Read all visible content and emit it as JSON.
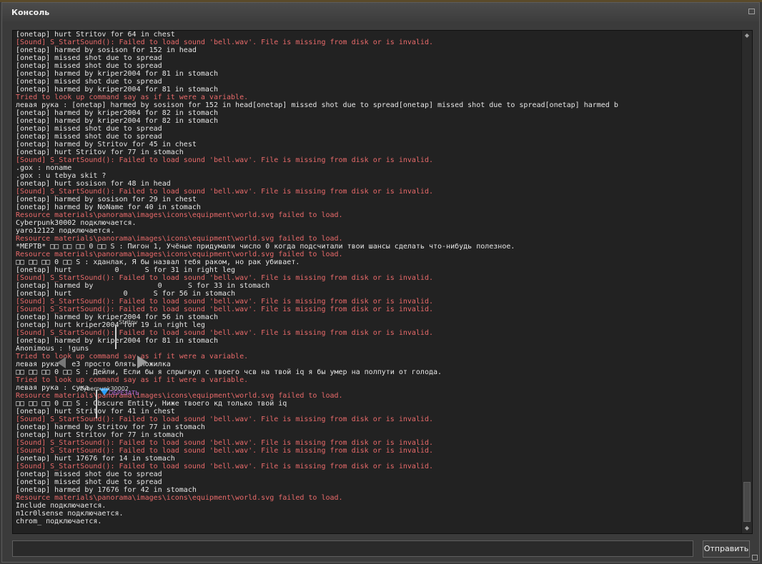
{
  "window": {
    "title": "Консоль",
    "submit_label": "Отправить",
    "input_value": ""
  },
  "log": [
    {
      "c": "white",
      "t": "[onetap] hurt Stritov for 64 in chest"
    },
    {
      "c": "red",
      "t": "[Sound] S_StartSound(): Failed to load sound 'bell.wav'. File is missing from disk or is invalid."
    },
    {
      "c": "white",
      "t": "[onetap] harmed by sosison for 152 in head"
    },
    {
      "c": "white",
      "t": "[onetap] missed shot due to spread"
    },
    {
      "c": "white",
      "t": "[onetap] missed shot due to spread"
    },
    {
      "c": "white",
      "t": "[onetap] harmed by kriper2004 for 81 in stomach"
    },
    {
      "c": "white",
      "t": "[onetap] missed shot due to spread"
    },
    {
      "c": "white",
      "t": "[onetap] harmed by kriper2004 for 81 in stomach"
    },
    {
      "c": "red",
      "t": "Tried to look up command say as if it were a variable."
    },
    {
      "c": "white",
      "t": "левая рука : [onetap] harmed by sosison for 152 in head[onetap] missed shot due to spread[onetap] missed shot due to spread[onetap] harmed b"
    },
    {
      "c": "white",
      "t": "[onetap] harmed by kriper2004 for 82 in stomach"
    },
    {
      "c": "white",
      "t": "[onetap] harmed by kriper2004 for 82 in stomach"
    },
    {
      "c": "white",
      "t": "[onetap] missed shot due to spread"
    },
    {
      "c": "white",
      "t": "[onetap] missed shot due to spread"
    },
    {
      "c": "white",
      "t": "[onetap] harmed by Stritov for 45 in chest"
    },
    {
      "c": "white",
      "t": "[onetap] hurt Stritov for 77 in stomach"
    },
    {
      "c": "red",
      "t": "[Sound] S_StartSound(): Failed to load sound 'bell.wav'. File is missing from disk or is invalid."
    },
    {
      "c": "white",
      "t": ".gox : noname"
    },
    {
      "c": "white",
      "t": ".gox : u tebya skit ?"
    },
    {
      "c": "white",
      "t": "[onetap] hurt sosison for 48 in head"
    },
    {
      "c": "red",
      "t": "[Sound] S_StartSound(): Failed to load sound 'bell.wav'. File is missing from disk or is invalid."
    },
    {
      "c": "white",
      "t": "[onetap] harmed by sosison for 29 in chest"
    },
    {
      "c": "white",
      "t": "[onetap] harmed by NoName for 40 in stomach"
    },
    {
      "c": "red",
      "t": "Resource materials\\panorama\\images\\icons\\equipment\\world.svg failed to load."
    },
    {
      "c": "white",
      "t": "Cyberpunk30002 подключается."
    },
    {
      "c": "white",
      "t": "yaro12122 подключается."
    },
    {
      "c": "red",
      "t": "Resource materials\\panorama\\images\\icons\\equipment\\world.svg failed to load."
    },
    {
      "c": "white",
      "t": "*МЕРТВ* □□ □□ □□ 0 □□ S : Пигон 1, Учёные придумали число 0 когда подсчитали твои шансы сделать что-нибудь полезное."
    },
    {
      "c": "red",
      "t": "Resource materials\\panorama\\images\\icons\\equipment\\world.svg failed to load."
    },
    {
      "c": "white",
      "t": "□□ □□ □□ 0 □□ S : хданлак, Я бы назвал тебя раком, но рак убивает."
    },
    {
      "c": "white",
      "t": "[onetap] hurt          0      S for 31 in right leg"
    },
    {
      "c": "red",
      "t": "[Sound] S_StartSound(): Failed to load sound 'bell.wav'. File is missing from disk or is invalid."
    },
    {
      "c": "white",
      "t": "[onetap] harmed by               0      S for 33 in stomach"
    },
    {
      "c": "white",
      "t": "[onetap] hurt            0      S for 56 in stomach"
    },
    {
      "c": "red",
      "t": "[Sound] S_StartSound(): Failed to load sound 'bell.wav'. File is missing from disk or is invalid."
    },
    {
      "c": "red",
      "t": "[Sound] S_StartSound(): Failed to load sound 'bell.wav'. File is missing from disk or is invalid."
    },
    {
      "c": "white",
      "t": "[onetap] harmed by kriper2004 for 56 in stomach"
    },
    {
      "c": "white",
      "t": "[onetap] hurt kriper2004 for 19 in right leg"
    },
    {
      "c": "red",
      "t": "[Sound] S_StartSound(): Failed to load sound 'bell.wav'. File is missing from disk or is invalid."
    },
    {
      "c": "white",
      "t": "[onetap] harmed by kriper2004 for 81 in stomach"
    },
    {
      "c": "white",
      "t": "Anonimous : !guns"
    },
    {
      "c": "red",
      "t": "Tried to look up command say as if it were a variable."
    },
    {
      "c": "white",
      "t": "левая рука : е3 просто блять пожилка"
    },
    {
      "c": "white",
      "t": "□□ □□ □□ 0 □□ S : Дейли, Если бы я спрыгнул с твоего чсв на твой iq я бы умер на полпути от голода."
    },
    {
      "c": "red",
      "t": "Tried to look up command say as if it were a variable."
    },
    {
      "c": "white",
      "t": "левая рука : сука"
    },
    {
      "c": "red",
      "t": "Resource materials\\panorama\\images\\icons\\equipment\\world.svg failed to load."
    },
    {
      "c": "white",
      "t": "□□ □□ □□ 0 □□ S : Obscure Entity, Ниже твоего кд только твой iq"
    },
    {
      "c": "white",
      "t": "[onetap] hurt Stritov for 41 in chest"
    },
    {
      "c": "red",
      "t": "[Sound] S_StartSound(): Failed to load sound 'bell.wav'. File is missing from disk or is invalid."
    },
    {
      "c": "white",
      "t": "[onetap] harmed by Stritov for 77 in stomach"
    },
    {
      "c": "white",
      "t": "[onetap] hurt Stritov for 77 in stomach"
    },
    {
      "c": "red",
      "t": "[Sound] S_StartSound(): Failed to load sound 'bell.wav'. File is missing from disk or is invalid."
    },
    {
      "c": "red",
      "t": "[Sound] S_StartSound(): Failed to load sound 'bell.wav'. File is missing from disk or is invalid."
    },
    {
      "c": "white",
      "t": "[onetap] hurt 17676 for 14 in stomach"
    },
    {
      "c": "red",
      "t": "[Sound] S_StartSound(): Failed to load sound 'bell.wav'. File is missing from disk or is invalid."
    },
    {
      "c": "white",
      "t": "[onetap] missed shot due to spread"
    },
    {
      "c": "white",
      "t": "[onetap] missed shot due to spread"
    },
    {
      "c": "white",
      "t": "[onetap] harmed by 17676 for 42 in stomach"
    },
    {
      "c": "red",
      "t": "Resource materials\\panorama\\images\\icons\\equipment\\world.svg failed to load."
    },
    {
      "c": "white",
      "t": "Include подключается."
    },
    {
      "c": "white",
      "t": "n1cr0lsense подключается."
    },
    {
      "c": "white",
      "t": "chrom_ подключается."
    }
  ],
  "overlay": {
    "name1": "Stritov",
    "name2": "Cyberpunk30002",
    "tag": "ОБРЕЗАТЬ"
  }
}
